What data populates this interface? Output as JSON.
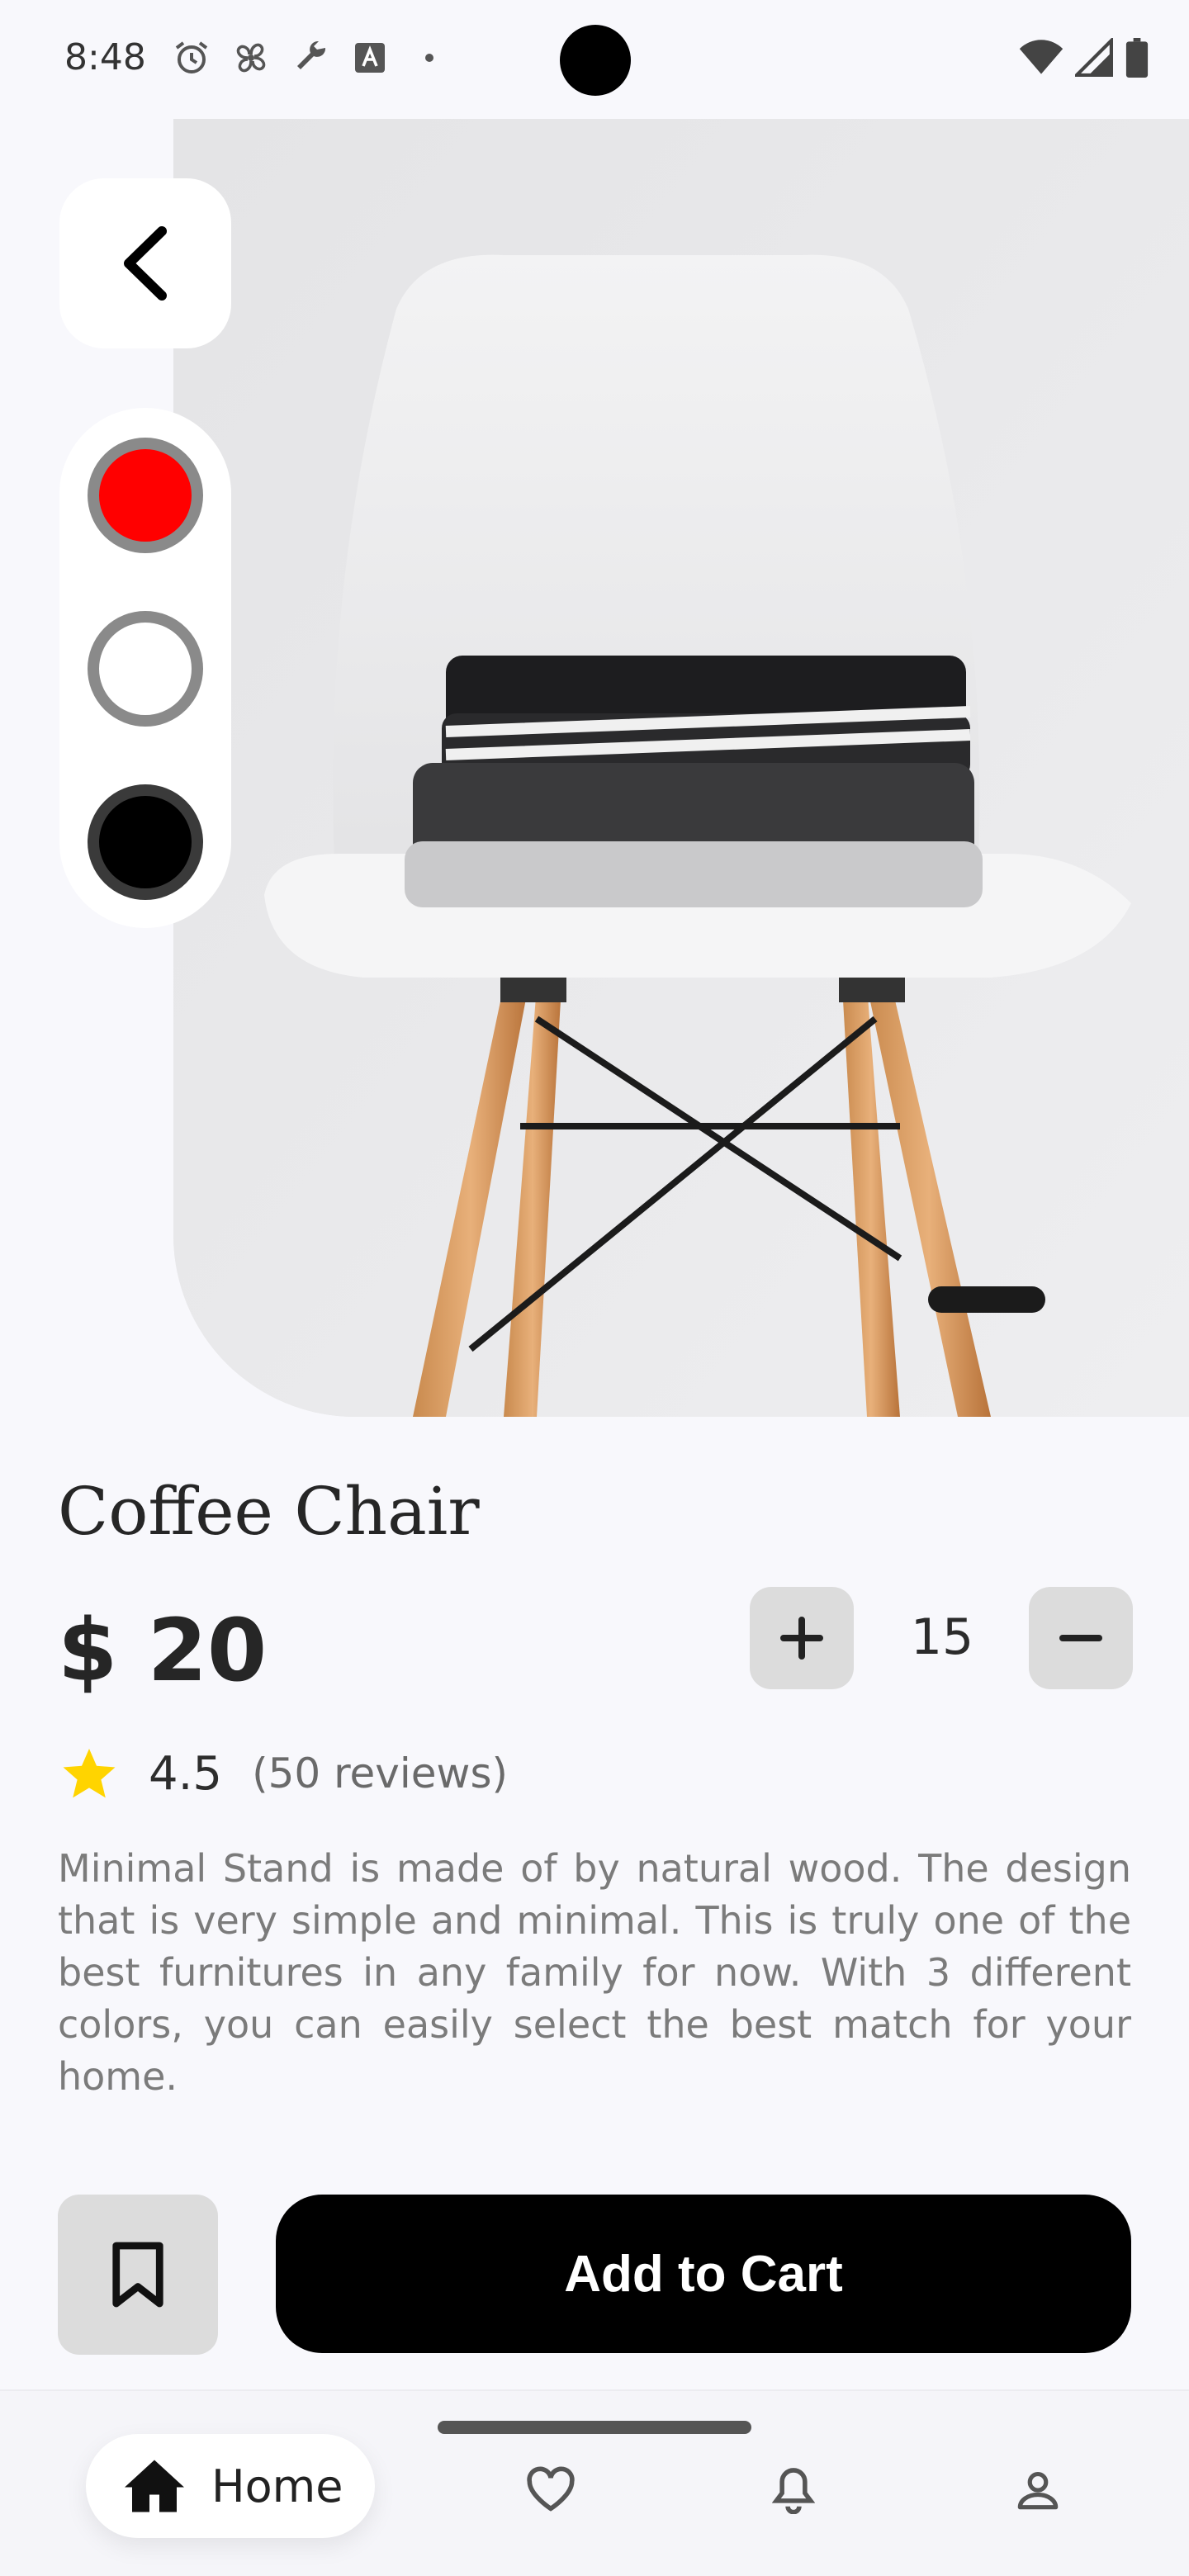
{
  "status_bar": {
    "time": "8:48",
    "left_icons": [
      "alarm-icon",
      "fan-icon",
      "wrench-icon",
      "font-icon",
      "dot-icon"
    ],
    "right_icons": [
      "wifi-icon",
      "signal-icon",
      "battery-icon"
    ]
  },
  "product": {
    "title": "Coffee Chair",
    "price": "$ 20",
    "quantity": "15",
    "rating": "4.5",
    "reviews": "(50 reviews)",
    "description": "Minimal Stand is made of by natural wood. The design that is very simple and minimal. This is truly one of the best furnitures in any family for now. With 3 different colors, you can easily select the best match for your home.",
    "colors": [
      {
        "name": "red",
        "hex": "#ff0000",
        "selected": true
      },
      {
        "name": "white",
        "hex": "#ffffff",
        "selected": false
      },
      {
        "name": "black",
        "hex": "#000000",
        "selected": false
      }
    ]
  },
  "actions": {
    "add_to_cart": "Add to Cart"
  },
  "bottom_nav": {
    "home_label": "Home",
    "items": [
      "home-icon",
      "heart-icon",
      "bell-icon",
      "profile-icon"
    ]
  }
}
